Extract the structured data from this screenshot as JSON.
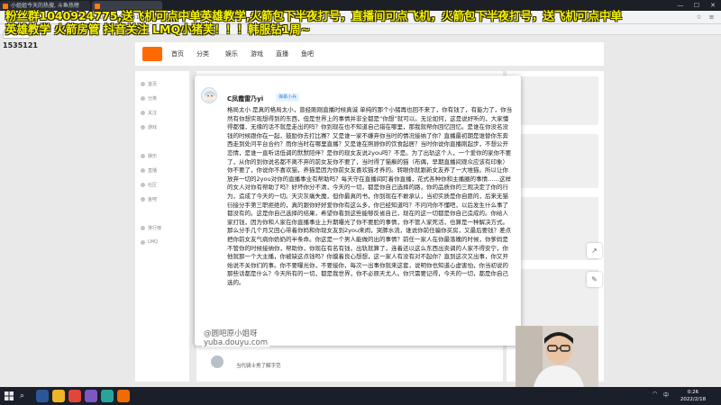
{
  "browser": {
    "tab1_title": "小姐姐今天的热搜, 斗鱼热榜",
    "tab2_title": "",
    "url": "yuba.douyu.com/p/576643781541100708",
    "minimize": "—",
    "maximize": "☐",
    "close": "✕"
  },
  "stream": {
    "banner": "粉丝群1040924775,送飞机可点中单英雄教学,火箭包下半夜打号，直播间可点飞机，火箭包下半夜打号，送飞机可点中单英雄教学 火箭房管 抖音关注 LMQ小猪芙！！！韩服钻1周~",
    "viewer_count": "1535121",
    "watermark_line1": "@圆吧原小姐呀",
    "watermark_line2": "yuba.douyu.com"
  },
  "site": {
    "nav": [
      "首页",
      "分类",
      "娱乐",
      "游戏",
      "直播",
      "鱼吧"
    ],
    "sidebar": [
      "首页",
      "分类",
      "关注",
      "游戏",
      "娱乐",
      "直播",
      "社区",
      "鱼吧",
      "排行榜",
      "LMQ"
    ],
    "comment_placeholder": "当代骑士男了解字范"
  },
  "post": {
    "author": "C凤霞雷乃yi",
    "badge": "弹幕小兵",
    "body": "格局太小 是真的格局太小，曾经刚刚直播时候真诚 单纯的那个小猪再也回不来了，你有钱了，有能力了，你当然有你想实现想得到的东西，但是世界上的事情并非全都是“你想”就可以。无论如何，这是说好听的，大家懂得都懂，无缘的话不就是走出的吗？你到现在也不知道自己错在哪里，那我就帮你回忆回忆。是谁在你没名没钱的时候跟你在一起，鼓励你去打比赛？又是谁一家不嫌弃你当时的情况接纳了你？直播最初期是谁替你东奔西走到处问平台合约？而你当时在哪里直播？又是谁在照顾你的饮食起居？当时你说你直播刚起步，不想公开恋情，是谁一直听话低调的默默陪伴？是你的现女友说2you吗？不是。为了出轨这个人，一个爱你的家你不要了，从你的到你说名都不离不弃的前女友你不要了，当时得了猫癣的猫（布偶，早期直播间观众应该有印象）你不要了，你说你不喜欢猫，养猫是因为你前女友喜欢猫才养的。转眼你就跟新女友养了一大堆猫。所以让你放弃一切的2you对你的直播事业有帮助吗？每天守在直播间盯着你直播，花式各种你和主播圈的事情……这样的女人对你有帮助了吗？好坏你分不清，今天的一切，都是你自己选择的路，你的品质你的三观决定了你的行为，造成了今天的一切。天灾灰痛失魔，但你最真的书，你到现在不敢承认，当初实质是你自愿的，后来无猫衍接分手第三职拒绝的，真的跟你好好爱你你有这么多，你已经知道吗？不问问你不懂吧，以后发生什么事了都没有的。这是你自己选择的结果，希望你看到这些能够反省自己，现在的这一切都是你自己造成的。你给人家打钱，因为你和人家在你直播事业上升期曝光了你不要脸的事情，你不管人家死活，也算是一种解决方式。那么分手几个月又回心带着你妈和你现女友到2you来闹，哭肺水流，谁说你前任骗你买房，又最后要钱？差点把你前女友气病你奶奶的半条命。你这是一个男人能做的出的事情？前任一家人在你最落魄的时候，你爹妈是不管你的时候接纳你，帮助你，你现在有名有钱，出轨就算了，连着还以这么东西出卖调的人家不得安宁，你他就那一个大主播，你被缺这点钱吗？你摸着良心想想，这一家人有没有对不起你？直到这次又出事，你又开始说不关你们的事。你不要曝光你，不要接你，每次一出事你就来这套，说明你也知道心虚害怕，你当初说的那些话都是什么？今天所有的一切，都是我世界，你不必原天尤人。你只需要记得，今天的一切，都是你自己选的。"
  },
  "taskbar": {
    "start": "start",
    "search": "⌕",
    "time": "0:26",
    "date": "2022/2/18",
    "lang": "中"
  },
  "colors": {
    "brand": "#ff6a00",
    "banner_text": "#f5f500",
    "badge_bg": "#e8f3ff",
    "badge_text": "#3b83d8"
  }
}
